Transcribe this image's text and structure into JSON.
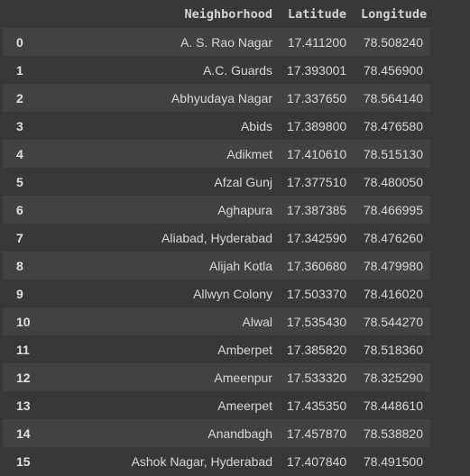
{
  "table": {
    "columns": [
      "",
      "Neighborhood",
      "Latitude",
      "Longitude"
    ],
    "rows": [
      {
        "index": "0",
        "neighborhood": "A. S. Rao Nagar",
        "latitude": "17.411200",
        "longitude": "78.508240"
      },
      {
        "index": "1",
        "neighborhood": "A.C. Guards",
        "latitude": "17.393001",
        "longitude": "78.456900"
      },
      {
        "index": "2",
        "neighborhood": "Abhyudaya Nagar",
        "latitude": "17.337650",
        "longitude": "78.564140"
      },
      {
        "index": "3",
        "neighborhood": "Abids",
        "latitude": "17.389800",
        "longitude": "78.476580"
      },
      {
        "index": "4",
        "neighborhood": "Adikmet",
        "latitude": "17.410610",
        "longitude": "78.515130"
      },
      {
        "index": "5",
        "neighborhood": "Afzal Gunj",
        "latitude": "17.377510",
        "longitude": "78.480050"
      },
      {
        "index": "6",
        "neighborhood": "Aghapura",
        "latitude": "17.387385",
        "longitude": "78.466995"
      },
      {
        "index": "7",
        "neighborhood": "Aliabad, Hyderabad",
        "latitude": "17.342590",
        "longitude": "78.476260"
      },
      {
        "index": "8",
        "neighborhood": "Alijah Kotla",
        "latitude": "17.360680",
        "longitude": "78.479980"
      },
      {
        "index": "9",
        "neighborhood": "Allwyn Colony",
        "latitude": "17.503370",
        "longitude": "78.416020"
      },
      {
        "index": "10",
        "neighborhood": "Alwal",
        "latitude": "17.535430",
        "longitude": "78.544270"
      },
      {
        "index": "11",
        "neighborhood": "Amberpet",
        "latitude": "17.385820",
        "longitude": "78.518360"
      },
      {
        "index": "12",
        "neighborhood": "Ameenpur",
        "latitude": "17.533320",
        "longitude": "78.325290"
      },
      {
        "index": "13",
        "neighborhood": "Ameerpet",
        "latitude": "17.435350",
        "longitude": "78.448610"
      },
      {
        "index": "14",
        "neighborhood": "Anandbagh",
        "latitude": "17.457870",
        "longitude": "78.538820"
      },
      {
        "index": "15",
        "neighborhood": "Ashok Nagar, Hyderabad",
        "latitude": "17.407840",
        "longitude": "78.491500"
      }
    ]
  }
}
